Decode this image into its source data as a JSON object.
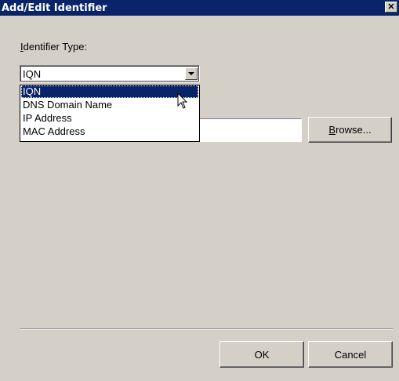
{
  "window": {
    "title": "Add/Edit Identifier",
    "close_glyph": "✕"
  },
  "identifier_type": {
    "label": "Identifier Type:",
    "label_mnemonic": "I",
    "label_rest": "dentifier Type:",
    "selected_value": "IQN",
    "options": [
      "IQN",
      "DNS Domain Name",
      "IP Address",
      "MAC Address"
    ],
    "highlighted_index": 0
  },
  "value_field": {
    "value": ""
  },
  "buttons": {
    "browse_label": "Browse...",
    "browse_mnemonic": "B",
    "browse_rest": "rowse...",
    "ok_label": "OK",
    "cancel_label": "Cancel"
  },
  "colors": {
    "titlebar": "#0a246a",
    "dialog_face": "#d4d0c8",
    "selection": "#0a246a"
  },
  "icons": {
    "cursor": "mouse-pointer-icon",
    "dropdown_arrow": "chevron-down-icon",
    "close": "close-icon"
  }
}
